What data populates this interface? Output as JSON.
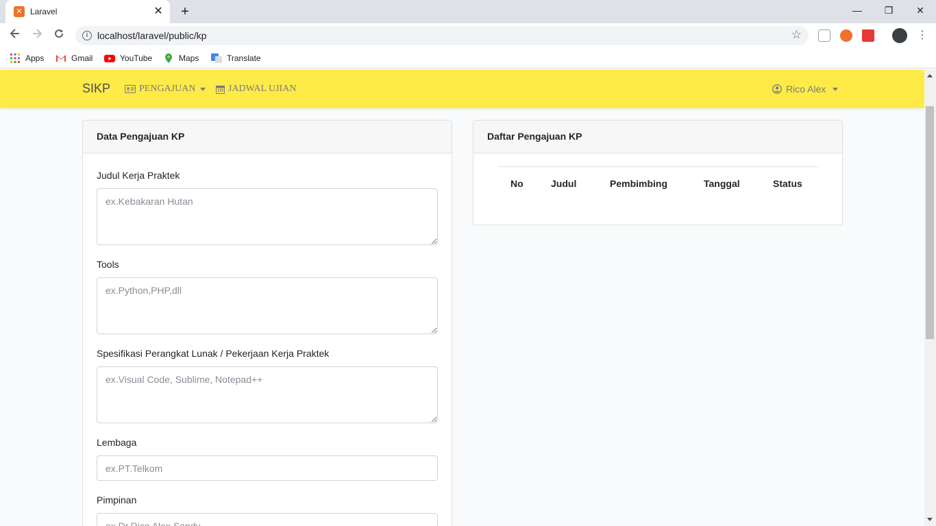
{
  "browser": {
    "tab_title": "Laravel",
    "tab_close": "✕",
    "new_tab": "+",
    "url": "localhost/laravel/public/kp",
    "bookmarks": [
      "Apps",
      "Gmail",
      "YouTube",
      "Maps",
      "Translate"
    ],
    "window_controls": {
      "minimize": "—",
      "maximize": "❐",
      "close": "✕"
    }
  },
  "navbar": {
    "brand": "SIKP",
    "links": [
      {
        "label": "PENGAJUAN",
        "icon": "id-card-icon",
        "dropdown": true
      },
      {
        "label": "JADWAL UJIAN",
        "icon": "calendar-icon",
        "dropdown": false
      }
    ],
    "user": "Rico Alex"
  },
  "form_card": {
    "title": "Data Pengajuan KP",
    "fields": [
      {
        "label": "Judul Kerja Praktek",
        "placeholder": "ex.Kebakaran Hutan"
      },
      {
        "label": "Tools",
        "placeholder": "ex.Python,PHP,dll"
      },
      {
        "label": "Spesifikasi Perangkat Lunak / Pekerjaan Kerja Praktek",
        "placeholder": "ex.Visual Code, Sublime, Notepad++"
      },
      {
        "label": "Lembaga",
        "placeholder": "ex.PT.Telkom"
      },
      {
        "label": "Pimpinan",
        "placeholder": "ex.Dr.Rico Alex Sandy"
      }
    ]
  },
  "list_card": {
    "title": "Daftar Pengajuan KP",
    "columns": [
      "No",
      "Judul",
      "Pembimbing",
      "Tanggal",
      "Status"
    ]
  },
  "colors": {
    "navbar": "#ffeb47",
    "text_muted": "#7a7a7a"
  }
}
